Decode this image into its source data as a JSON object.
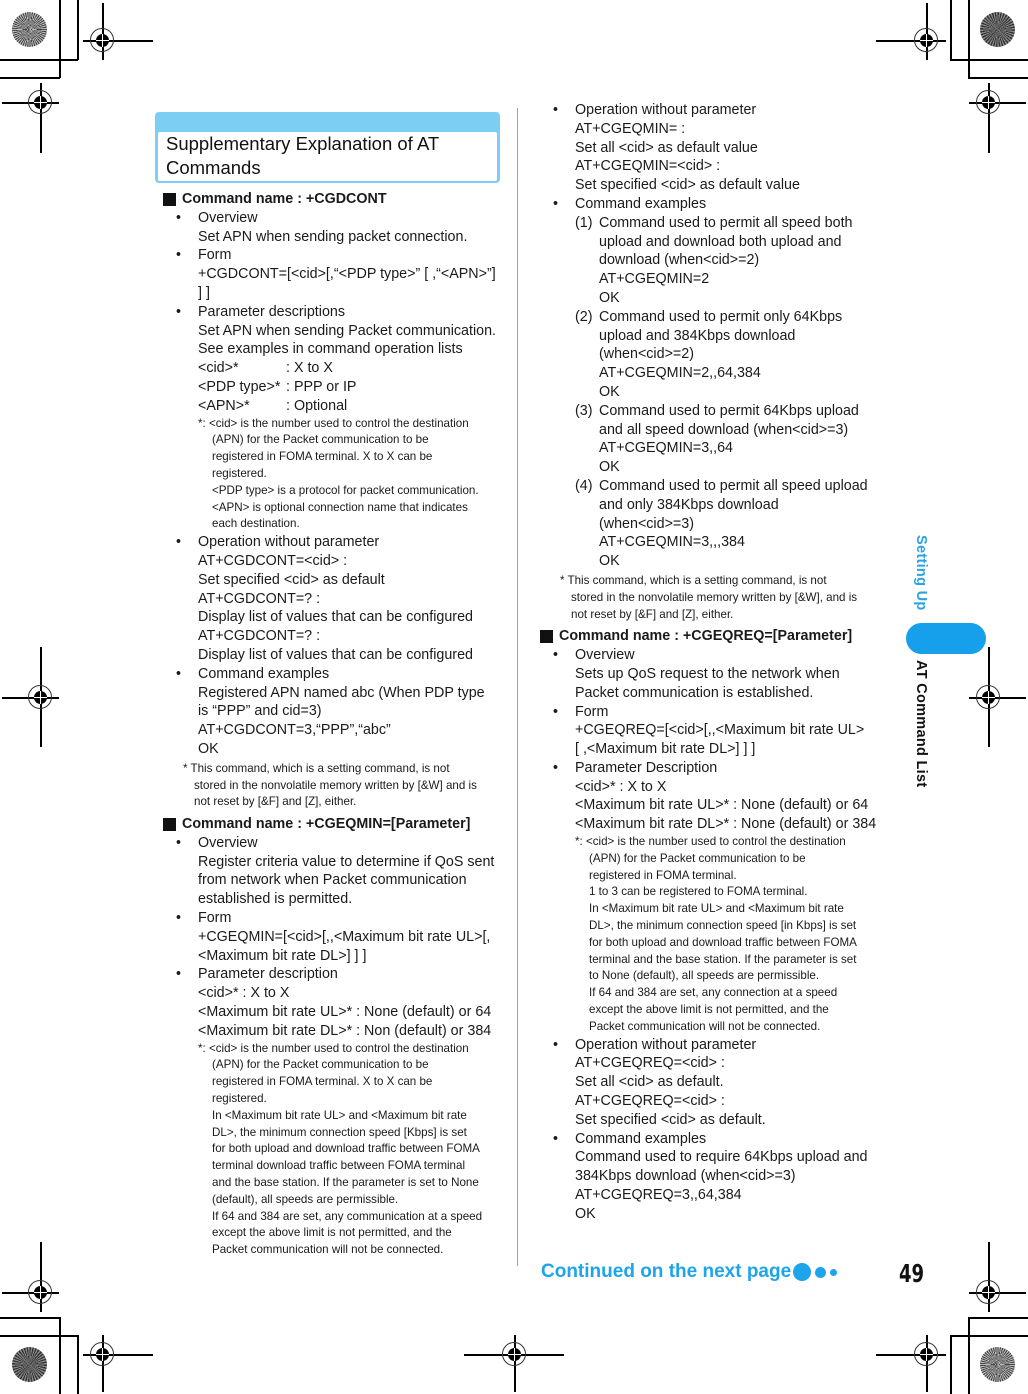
{
  "title": {
    "line1": "Supplementary Explanation of AT",
    "line2": "Commands"
  },
  "side_tab": {
    "section": "Setting Up",
    "chapter": "AT Command List",
    "accent": "#16a0ec"
  },
  "cgdcont": {
    "heading": "Command name : +CGDCONT",
    "overview_label": "Overview",
    "overview_text": "Set APN when sending packet connection.",
    "form_label": "Form",
    "form_line1": "+CGDCONT=[<cid>[,“<PDP type>” [ ,“<APN>”]",
    "form_line2": "] ]",
    "params_label": "Parameter descriptions",
    "params_line1": "Set APN when sending Packet communication.",
    "params_line2": "See examples in command operation lists",
    "params": [
      {
        "key": "<cid>*",
        "value": ": X to X"
      },
      {
        "key": "<PDP type>*",
        "value": ": PPP or IP"
      },
      {
        "key": "<APN>*",
        "value": ": Optional"
      }
    ],
    "note_lines": [
      "*:  <cid> is the number used to control the destination",
      "(APN) for the Packet communication to be",
      "registered in FOMA terminal. X to X can be",
      "registered.",
      "<PDP type> is a protocol for packet communication.",
      "<APN> is optional connection name that indicates",
      "each destination."
    ],
    "op_label": "Operation without parameter",
    "op_lines": [
      "AT+CGDCONT=<cid> :",
      "Set specified <cid> as default",
      "AT+CGDCONT=? :",
      "Display list of values that can be configured",
      "AT+CGDCONT=? :",
      "Display list of values that can be configured"
    ],
    "examples_label": "Command examples",
    "examples_lines": [
      "Registered APN named abc (When PDP type",
      "is “PPP” and cid=3)",
      "AT+CGDCONT=3,“PPP”,“abc”",
      "OK"
    ],
    "footnote_lines": [
      "*  This command, which is a setting command, is not",
      "stored in the nonvolatile memory written by [&W] and is",
      "not reset by [&F] and [Z], either."
    ]
  },
  "cgeqmin": {
    "heading": "Command name : +CGEQMIN=[Parameter]",
    "overview_label": "Overview",
    "overview_lines": [
      "Register criteria value to determine if QoS sent",
      "from network when Packet communication",
      "established is permitted."
    ],
    "form_label": "Form",
    "form_lines": [
      "+CGEQMIN=[<cid>[,,<Maximum bit rate UL>[,",
      "<Maximum bit rate DL>] ] ]"
    ],
    "params_label": "Parameter description",
    "params_lines": [
      "<cid>* : X to X",
      "<Maximum bit rate UL>* : None (default) or 64",
      "<Maximum bit rate DL>* : Non (default) or 384"
    ],
    "note_lines": [
      "*:  <cid> is the number used to control the destination",
      "(APN) for the Packet communication to be",
      "registered in FOMA terminal. X to X can be",
      "registered.",
      "In <Maximum bit rate UL> and <Maximum bit rate",
      "DL>, the minimum connection speed [Kbps] is set",
      "for both upload and download traffic between FOMA",
      "terminal download traffic between FOMA terminal",
      "and the base station. If the parameter is set to None",
      "(default), all speeds are permissible.",
      "If 64 and 384 are set, any communication at a speed",
      "except the above limit is not permitted, and the",
      "Packet communication will not be connected."
    ],
    "op_label": "Operation without parameter",
    "op_lines": [
      "AT+CGEQMIN= :",
      "Set all <cid> as default value",
      "AT+CGEQMIN=<cid> :",
      "Set specified <cid> as default value"
    ],
    "examples_label": "Command examples",
    "examples": [
      {
        "num": "(1)",
        "lines": [
          "Command used to permit all speed both",
          "upload and download both upload and",
          "download (when<cid>=2)",
          "AT+CGEQMIN=2",
          "OK"
        ]
      },
      {
        "num": "(2)",
        "lines": [
          "Command used to permit only 64Kbps",
          "upload and 384Kbps download",
          "(when<cid>=2)",
          "AT+CGEQMIN=2,,64,384",
          "OK"
        ]
      },
      {
        "num": "(3)",
        "lines": [
          "Command used to permit 64Kbps upload",
          "and all speed download (when<cid>=3)",
          "AT+CGEQMIN=3,,64",
          "OK"
        ]
      },
      {
        "num": "(4)",
        "lines": [
          "Command used to permit all speed upload",
          "and only 384Kbps download",
          "(when<cid>=3)",
          "AT+CGEQMIN=3,,,384",
          "OK"
        ]
      }
    ],
    "footnote_lines": [
      "*  This command, which is a setting command, is not",
      "stored in the nonvolatile memory written by [&W], and is",
      "not reset by [&F] and [Z], either."
    ]
  },
  "cgeqreq": {
    "heading": "Command name : +CGEQREQ=[Parameter]",
    "overview_label": "Overview",
    "overview_lines": [
      "Sets up QoS request to the network when",
      "Packet communication is established."
    ],
    "form_label": "Form",
    "form_lines": [
      "+CGEQREQ=[<cid>[,,<Maximum bit  rate UL>",
      "[ ,<Maximum bit rate DL>] ] ]"
    ],
    "params_label": "Parameter Description",
    "params_lines": [
      "<cid>* : X to X",
      "<Maximum bit rate UL>* : None (default) or 64",
      "<Maximum bit rate DL>* : None (default) or 384"
    ],
    "note_lines": [
      "*:  <cid> is the number used to control the destination",
      "(APN) for the Packet communication to be",
      "registered in FOMA terminal.",
      "1 to 3 can be registered to FOMA terminal.",
      "In <Maximum bit rate UL> and <Maximum bit rate",
      "DL>, the minimum connection speed [in Kbps] is set",
      "for both upload and download traffic between FOMA",
      "terminal and the base station. If the parameter is set",
      "to None (default), all speeds are permissible.",
      "If 64 and 384 are set, any connection at a speed",
      "except the above limit is not permitted, and the",
      "Packet communication will not be connected."
    ],
    "op_label": "Operation without parameter",
    "op_lines": [
      "AT+CGEQREQ=<cid> :",
      "Set all <cid> as default.",
      "AT+CGEQREQ=<cid> :",
      "Set specified <cid> as default."
    ],
    "examples_label": "Command examples",
    "examples_lines": [
      "Command used to require 64Kbps upload and",
      "384Kbps download (when<cid>=3)",
      "AT+CGEQREQ=3,,64,384",
      "OK"
    ]
  },
  "footer": {
    "continued": "Continued on the next page",
    "page_number": "49",
    "accent": "#1ea4ea"
  }
}
